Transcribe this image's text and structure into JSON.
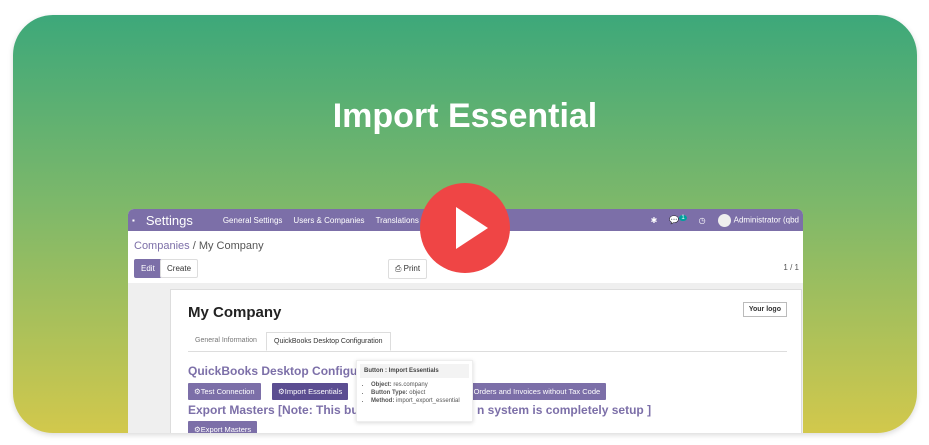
{
  "title": "Import Essential",
  "nav": {
    "app": "Settings",
    "menu": [
      "General Settings",
      "Users & Companies",
      "Translations"
    ],
    "badge": "1",
    "user": "Administrator (qbd"
  },
  "breadcrumb": {
    "parent": "Companies",
    "current": "My Company"
  },
  "toolbar": {
    "edit": "Edit",
    "create": "Create",
    "print": "Print",
    "pager": "1 / 1"
  },
  "form": {
    "name": "My Company",
    "logo": "Your logo",
    "tabs": [
      "General Information",
      "QuickBooks Desktop Configuration"
    ],
    "section1": "QuickBooks Desktop Configurat",
    "buttons": [
      "Test Connection",
      "Import Essentials",
      "ck Orders and Invoices without Tax Code"
    ],
    "section2": "Export Masters [Note: This butto",
    "section2_tail": "n system is completely setup ]",
    "export": "Export Masters"
  },
  "tooltip": {
    "header": "Button : Import Essentials",
    "items": [
      {
        "k": "Object:",
        "v": "res.company"
      },
      {
        "k": "Button Type:",
        "v": "object"
      },
      {
        "k": "Method:",
        "v": "import_export_essential"
      }
    ]
  }
}
